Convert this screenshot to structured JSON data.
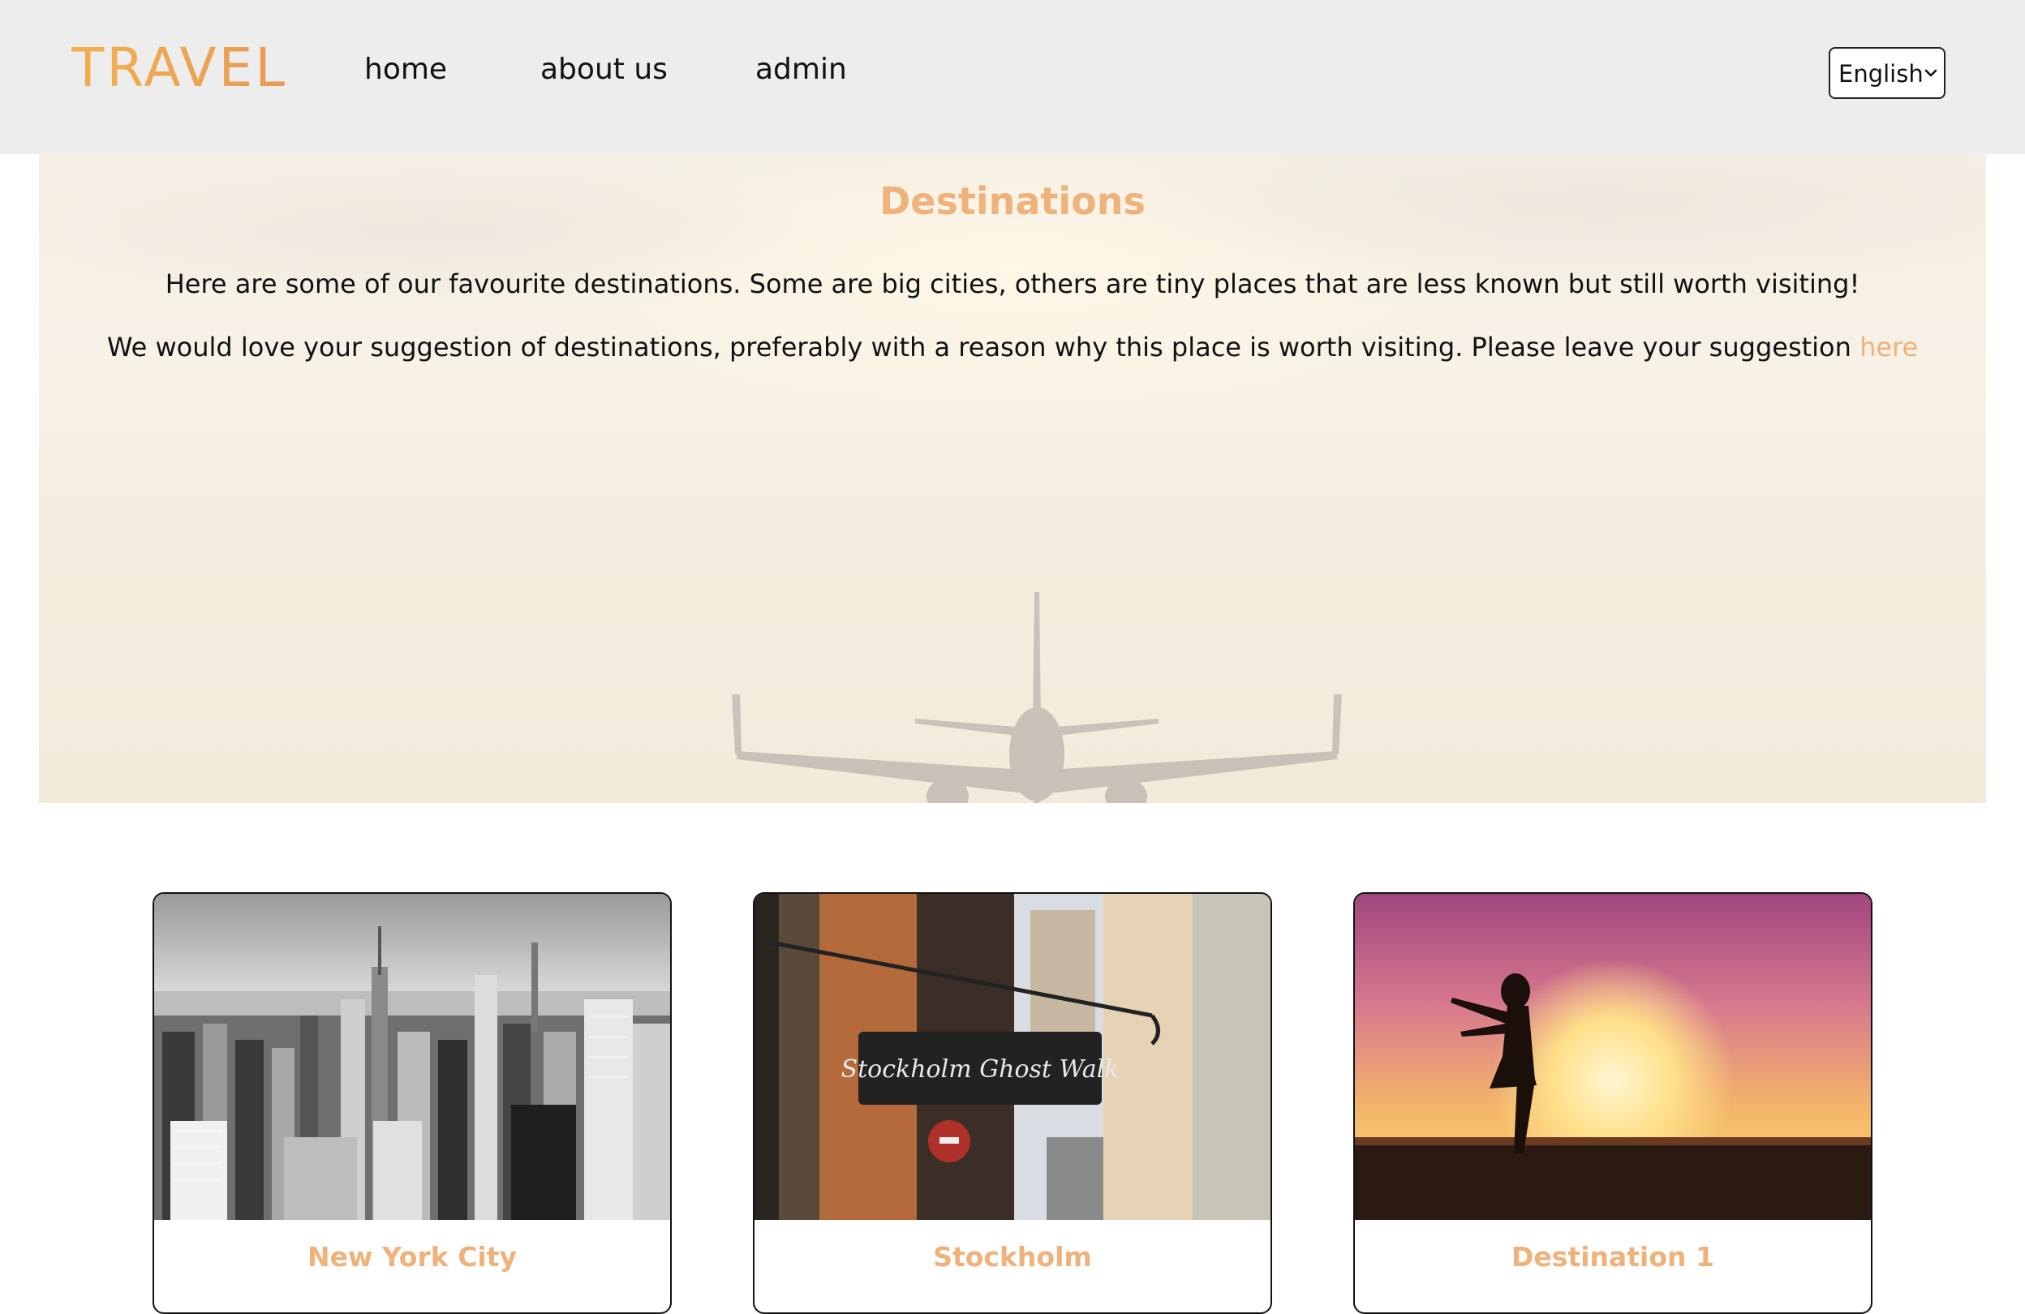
{
  "header": {
    "logo": "TRAVEL",
    "nav": [
      {
        "label": "home"
      },
      {
        "label": "about us"
      },
      {
        "label": "admin"
      }
    ],
    "language": {
      "selected": "English"
    }
  },
  "hero": {
    "title": "Destinations",
    "intro": "Here are some of our favourite destinations. Some are big cities, others are tiny places that are less known but still worth visiting!",
    "suggestion_text": "We would love your suggestion of destinations, preferably with a reason why this place is worth visiting. Please leave your suggestion ",
    "suggestion_link": "here"
  },
  "cards": [
    {
      "title": "New York City",
      "image": "new-york-skyline"
    },
    {
      "title": "Stockholm",
      "image": "stockholm-ghost-walk-sign",
      "sign_text": "Stockholm Ghost Walk"
    },
    {
      "title": "Destination 1",
      "image": "sunset-silhouette"
    }
  ],
  "colors": {
    "accent": "#eeb27a",
    "logo_gradient": [
      "#f2b04e",
      "#e89a55"
    ],
    "header_bg": "#ededed"
  }
}
